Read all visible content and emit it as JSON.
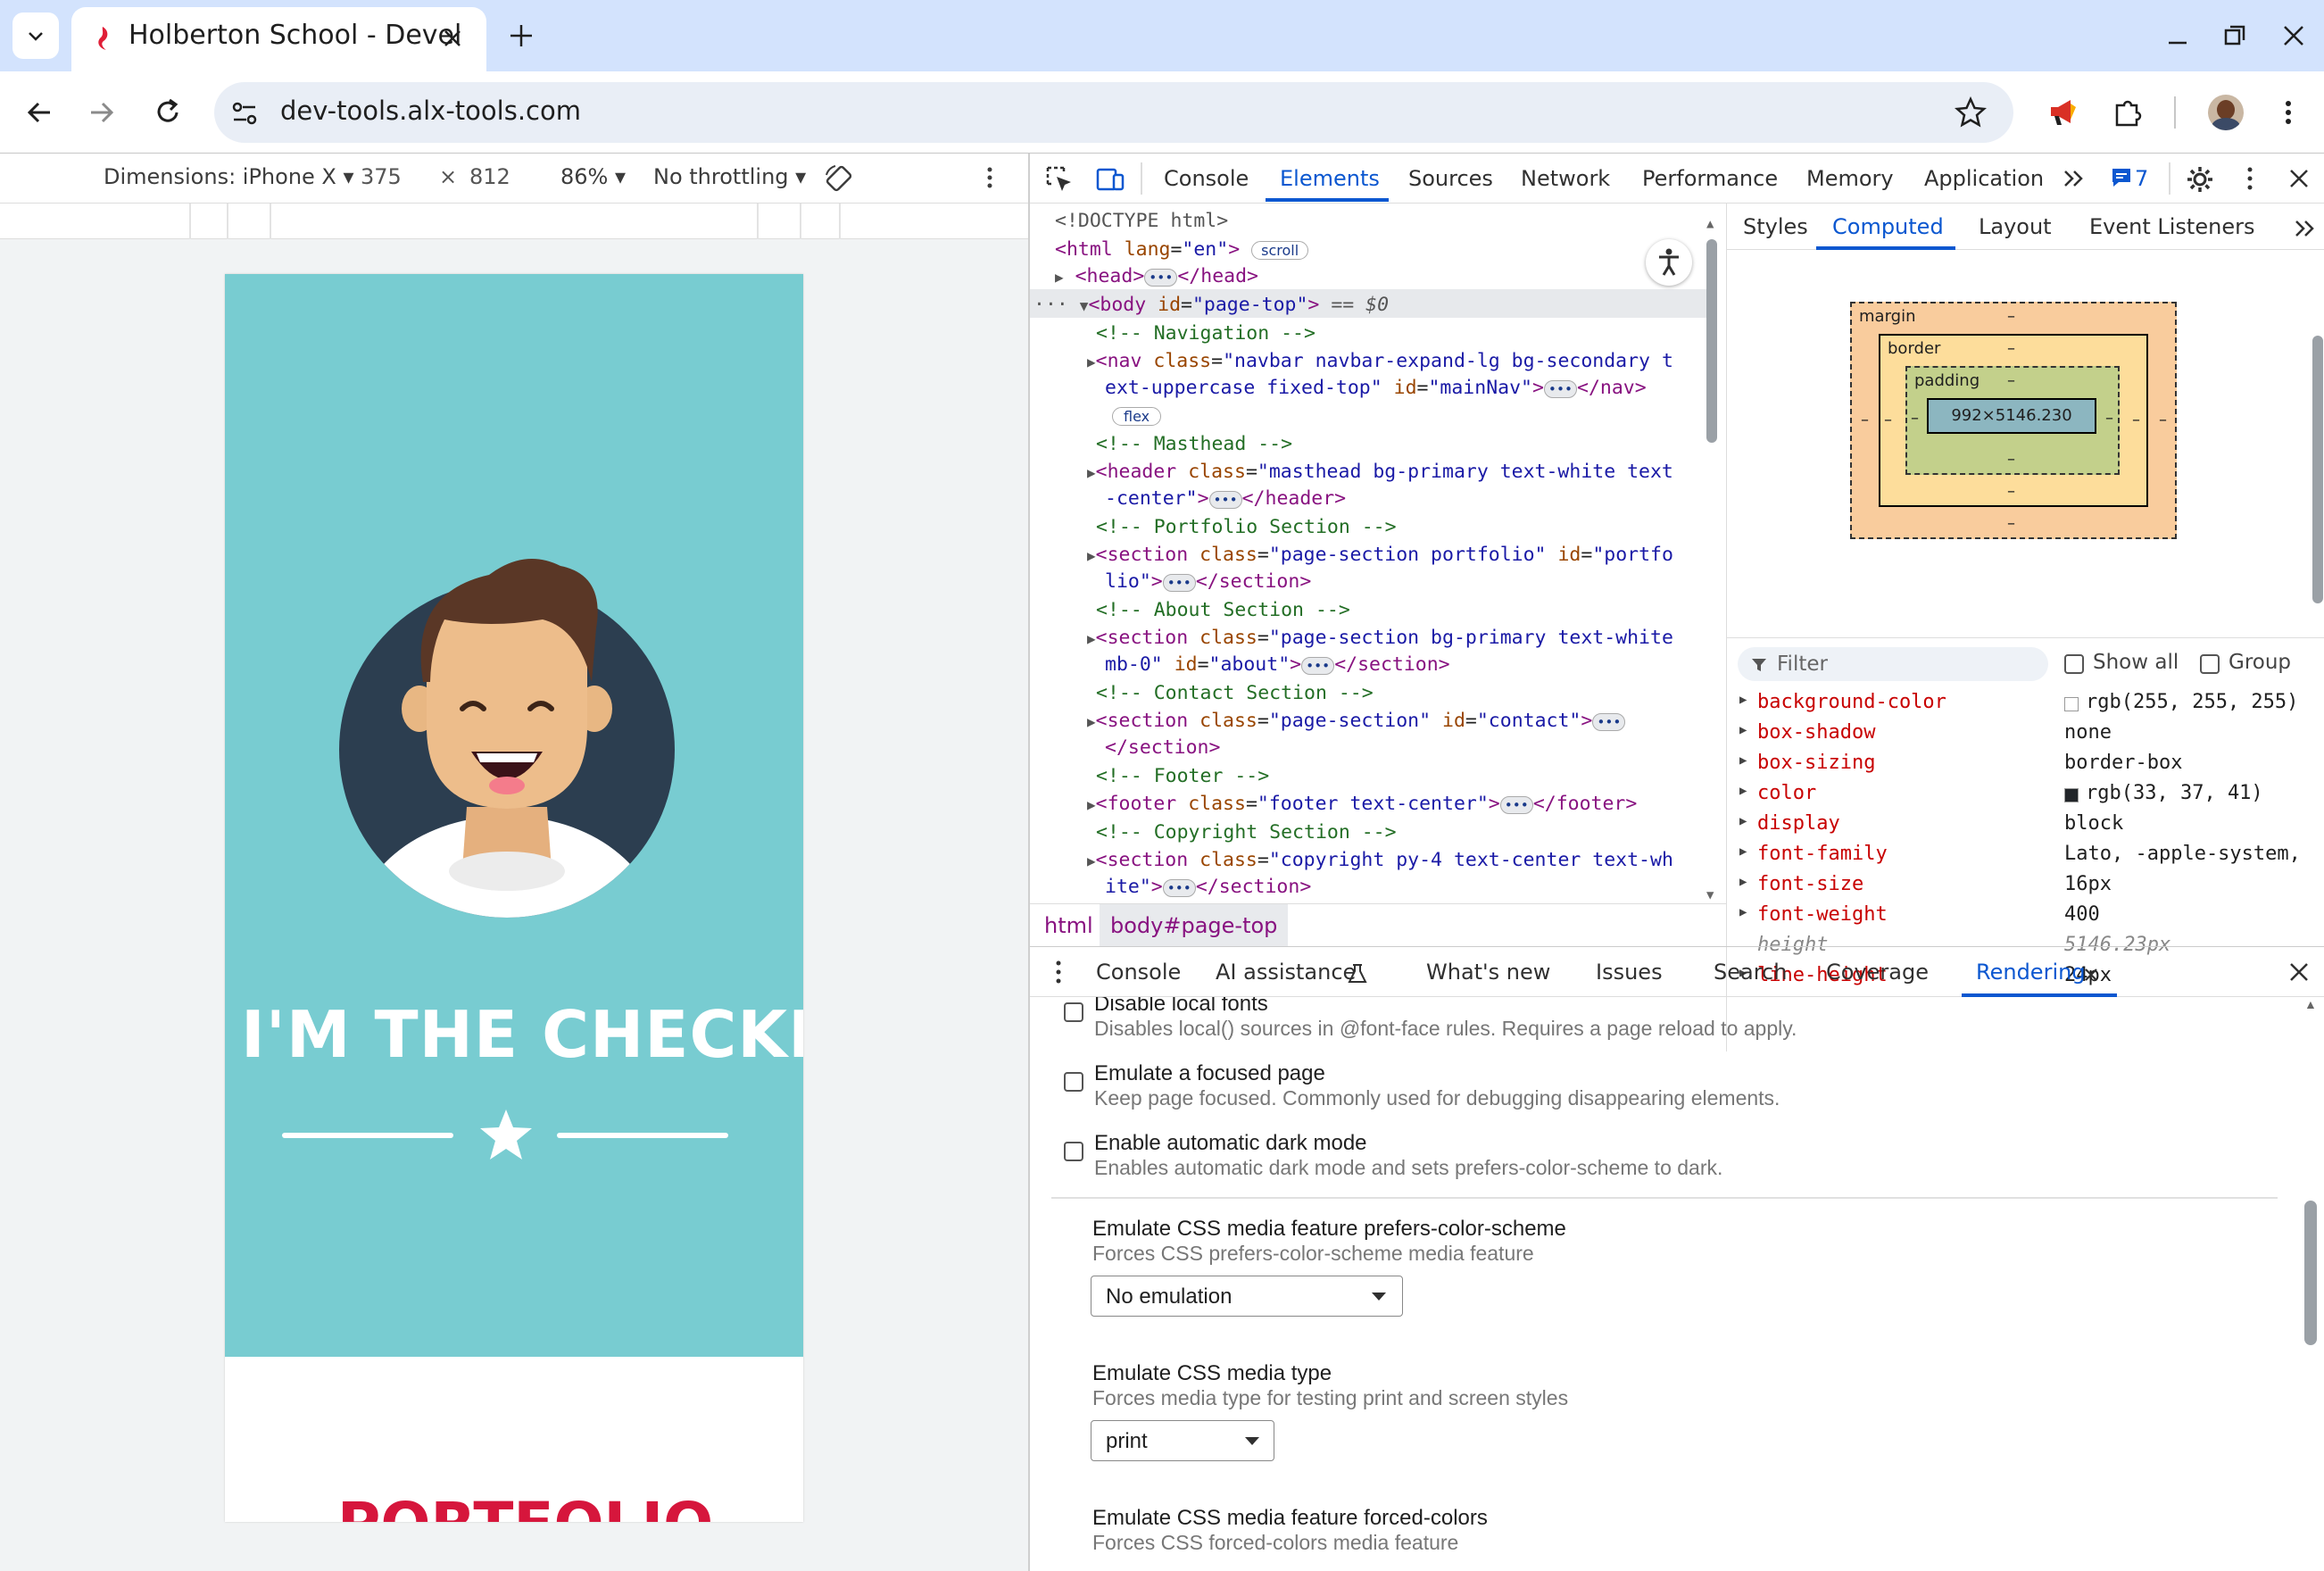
{
  "browser": {
    "tab_title": "Holberton School - Devel",
    "url": "dev-tools.alx-tools.com"
  },
  "device_toolbar": {
    "dimensions": "Dimensions: iPhone X",
    "width": "375",
    "times": "×",
    "height": "812",
    "zoom": "86%",
    "throttling": "No throttling"
  },
  "page": {
    "headline": "I'M THE CHECKE",
    "section_title": "PORTFOLIO"
  },
  "devtools": {
    "tabs": [
      "Console",
      "Elements",
      "Sources",
      "Network",
      "Performance",
      "Memory",
      "Application"
    ],
    "issues_count": "7",
    "elements_tree": {
      "doctype": "<!DOCTYPE html>",
      "html_open": "<html",
      "html_attr": "lang",
      "html_val": "\"en\"",
      "close": ">",
      "scroll_badge": "scroll",
      "head_open": "<head>",
      "head_close": "</head>",
      "body_open": "<body",
      "body_attr": "id",
      "body_val": "\"page-top\"",
      "body_marker": "== $0",
      "cmt_nav": "<!-- Navigation -->",
      "nav_open": "<nav",
      "class_attr": "class",
      "id_attr": "id",
      "nav_class_1": "\"navbar navbar-expand-lg bg-secondary t",
      "nav_class_2": "ext-uppercase fixed-top\"",
      "nav_id": "\"mainNav\"",
      "nav_close": "</nav>",
      "flex_badge": "flex",
      "cmt_masthead": "<!-- Masthead -->",
      "header_open": "<header",
      "header_class_1": "\"masthead bg-primary text-white text",
      "header_class_2": "-center\"",
      "header_close": "</header>",
      "cmt_portfolio": "<!-- Portfolio Section -->",
      "section_open": "<section",
      "portfolio_class": "\"page-section portfolio\"",
      "portfolio_id_1": "\"portfo",
      "portfolio_id_2": "lio\"",
      "section_close": "</section>",
      "cmt_about": "<!-- About Section -->",
      "about_class_1": "\"page-section bg-primary text-white",
      "about_class_2": "mb-0\"",
      "about_id": "\"about\"",
      "cmt_contact": "<!-- Contact Section -->",
      "contact_class": "\"page-section\"",
      "contact_id": "\"contact\"",
      "cmt_footer": "<!-- Footer -->",
      "footer_open": "<footer",
      "footer_class": "\"footer text-center\"",
      "footer_close": "</footer>",
      "cmt_copyright": "<!-- Copyright Section -->",
      "copyright_class_1": "\"copyright py-4 text-center text-wh",
      "copyright_class_2": "ite\""
    },
    "breadcrumb": [
      "html",
      "body#page-top"
    ],
    "styles_tabs": [
      "Styles",
      "Computed",
      "Layout",
      "Event Listeners"
    ],
    "box_model": {
      "margin": "margin",
      "border": "border",
      "padding": "padding",
      "dash": "–",
      "content": "992×5146.230"
    },
    "filter_placeholder": "Filter",
    "show_all": "Show all",
    "group": "Group",
    "computed": [
      {
        "name": "background-color",
        "value": "rgb(255, 255, 255)",
        "swatch": "#ffffff"
      },
      {
        "name": "box-shadow",
        "value": "none"
      },
      {
        "name": "box-sizing",
        "value": "border-box"
      },
      {
        "name": "color",
        "value": "rgb(33, 37, 41)",
        "swatch": "#212529"
      },
      {
        "name": "display",
        "value": "block"
      },
      {
        "name": "font-family",
        "value": "Lato, -apple-system,"
      },
      {
        "name": "font-size",
        "value": "16px"
      },
      {
        "name": "font-weight",
        "value": "400"
      },
      {
        "name": "height",
        "value": "5146.23px",
        "inherited": true
      },
      {
        "name": "line-height",
        "value": "24px"
      }
    ],
    "drawer_tabs": [
      "Console",
      "AI assistance",
      "What's new",
      "Issues",
      "Search",
      "Coverage",
      "Rendering"
    ],
    "rendering": {
      "disable_fonts_title": "Disable local fonts",
      "disable_fonts_desc": "Disables local() sources in @font-face rules. Requires a page reload to apply.",
      "focused_title": "Emulate a focused page",
      "focused_desc": "Keep page focused. Commonly used for debugging disappearing elements.",
      "dark_title": "Enable automatic dark mode",
      "dark_desc": "Enables automatic dark mode and sets prefers-color-scheme to dark.",
      "pcs_title": "Emulate CSS media feature prefers-color-scheme",
      "pcs_desc": "Forces CSS prefers-color-scheme media feature",
      "pcs_value": "No emulation",
      "media_title": "Emulate CSS media type",
      "media_desc": "Forces media type for testing print and screen styles",
      "media_value": "print",
      "forced_title": "Emulate CSS media feature forced-colors",
      "forced_desc": "Forces CSS forced-colors media feature"
    }
  },
  "colors": {
    "accent": "#0b57d0",
    "masthead": "#78ccd1",
    "portfolio": "#d6163c"
  }
}
